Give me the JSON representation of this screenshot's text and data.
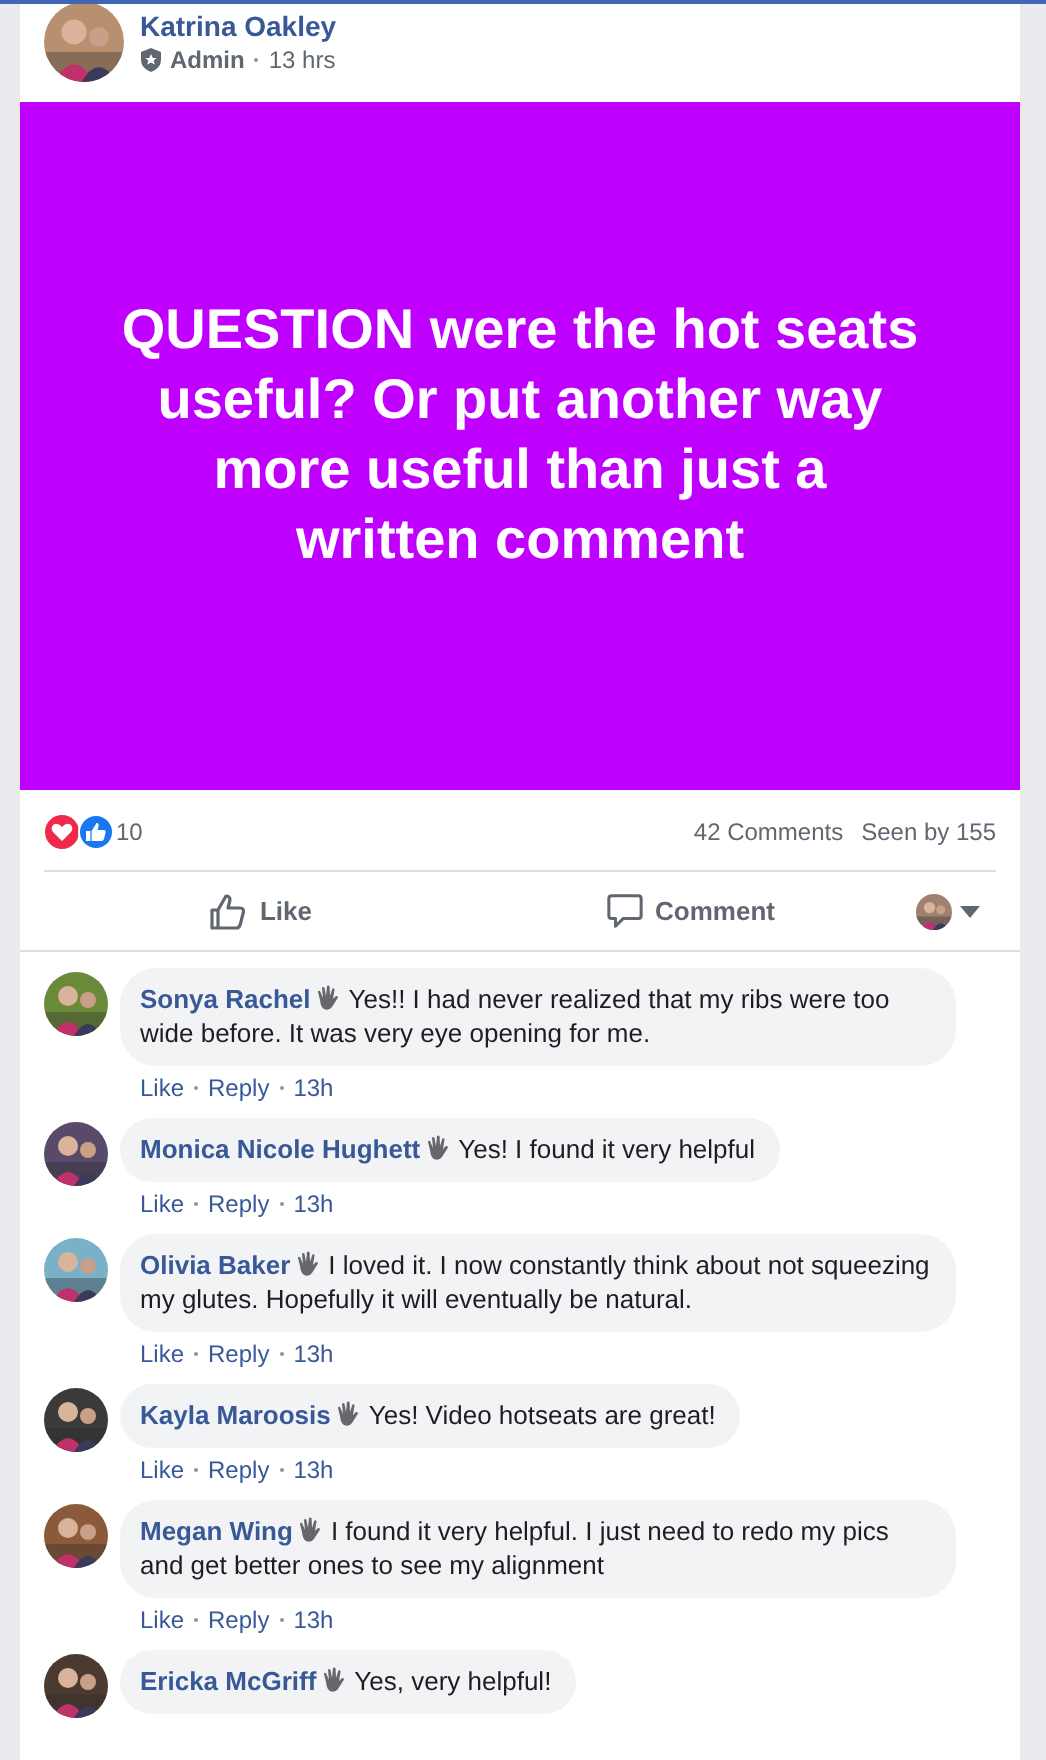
{
  "post": {
    "author": "Katrina Oakley",
    "role": "Admin",
    "time": "13 hrs",
    "text": "QUESTION were the hot seats useful? Or put another way more useful than just a written comment"
  },
  "stats": {
    "reactions_count": "10",
    "comments": "42 Comments",
    "seen": "Seen by 155"
  },
  "actions": [
    {
      "kind": "like",
      "label": "Like"
    },
    {
      "kind": "comment",
      "label": "Comment"
    }
  ],
  "comments": [
    {
      "name": "Sonya Rachel",
      "text": "Yes!! I had never realized that my ribs were too wide before. It was very eye opening for me.",
      "color": "#6a8a3a",
      "actions": [
        "Like",
        "Reply",
        "13h"
      ]
    },
    {
      "name": "Monica Nicole Hughett",
      "text": "Yes! I found it very helpful",
      "color": "#5a4a6a",
      "actions": [
        "Like",
        "Reply",
        "13h"
      ]
    },
    {
      "name": "Olivia Baker",
      "text": "I loved it. I now constantly think about not squeezing my glutes. Hopefully it will eventually be natural.",
      "color": "#7ab0c8",
      "actions": [
        "Like",
        "Reply",
        "13h"
      ]
    },
    {
      "name": "Kayla Maroosis",
      "text": "Yes! Video hotseats are great!",
      "color": "#3a3a3a",
      "actions": [
        "Like",
        "Reply",
        "13h"
      ]
    },
    {
      "name": "Megan Wing",
      "text": "I found it very helpful. I just need to redo my pics and get better ones to see my alignment",
      "color": "#8a5a3a",
      "actions": [
        "Like",
        "Reply",
        "13h"
      ]
    },
    {
      "name": "Ericka McGriff",
      "text": "Yes, very helpful!",
      "color": "#4a3a30"
    }
  ]
}
